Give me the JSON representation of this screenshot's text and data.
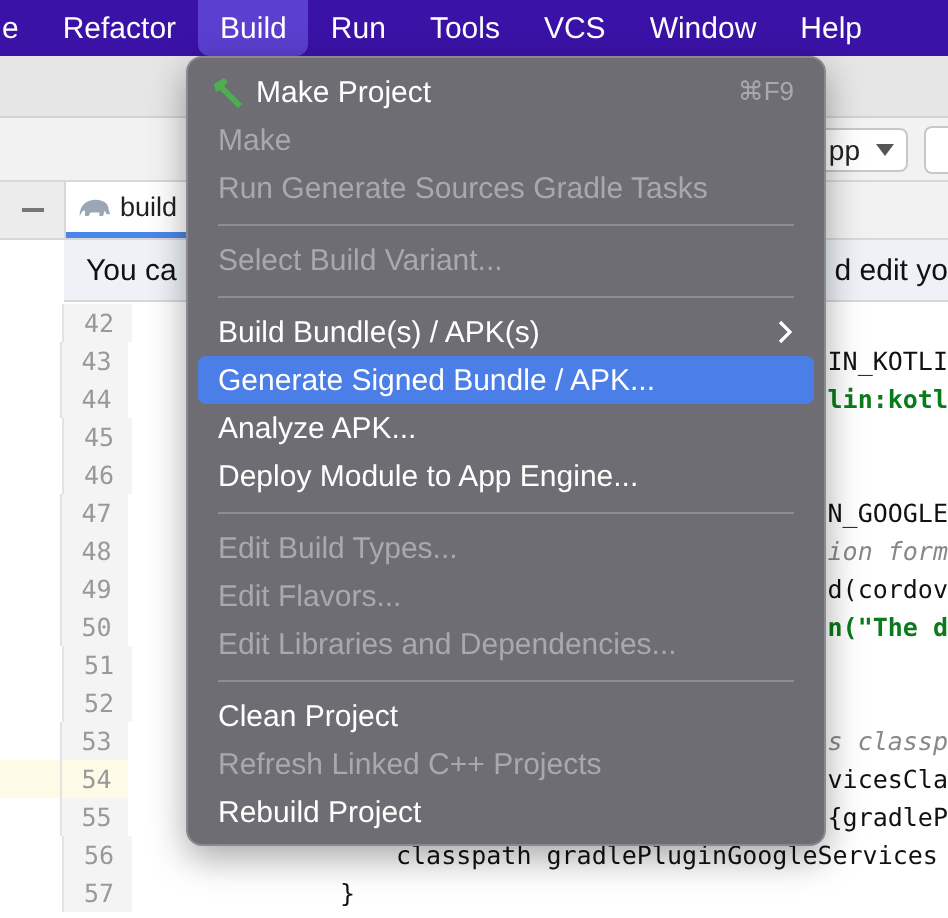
{
  "menu_bar": {
    "items": [
      {
        "label": "e",
        "selected": false
      },
      {
        "label": "Refactor",
        "selected": false
      },
      {
        "label": "Build",
        "selected": true
      },
      {
        "label": "Run",
        "selected": false
      },
      {
        "label": "Tools",
        "selected": false
      },
      {
        "label": "VCS",
        "selected": false
      },
      {
        "label": "Window",
        "selected": false
      },
      {
        "label": "Help",
        "selected": false
      }
    ]
  },
  "toolbar": {
    "config_dropdown": "pp"
  },
  "editor_tab": {
    "label": "build",
    "selected": true
  },
  "banner": {
    "texts": [
      "You ca",
      "d edit yo"
    ]
  },
  "code_lines": [
    {
      "number": "42",
      "kind": "clipped",
      "current": false
    },
    {
      "number": "43",
      "kind": "clipped",
      "text": "IN_KOTLI",
      "current": false
    },
    {
      "number": "44",
      "kind": "clipped_string",
      "text": "lin:kotl",
      "current": false
    },
    {
      "number": "45",
      "kind": "clipped",
      "current": false
    },
    {
      "number": "46",
      "kind": "clipped",
      "current": false
    },
    {
      "number": "47",
      "kind": "clipped",
      "text": "N_GOOGLE",
      "current": false
    },
    {
      "number": "48",
      "kind": "clipped_comment",
      "text": "ion form",
      "current": false
    },
    {
      "number": "49",
      "kind": "clipped",
      "text": "d(cordov",
      "current": false
    },
    {
      "number": "50",
      "kind": "clipped_string",
      "text": "n(\"The d",
      "current": false
    },
    {
      "number": "51",
      "kind": "clipped",
      "current": false
    },
    {
      "number": "52",
      "kind": "clipped",
      "current": false
    },
    {
      "number": "53",
      "kind": "clipped_comment",
      "text": "s classp",
      "current": false
    },
    {
      "number": "54",
      "kind": "clipped",
      "text": "vicesCla",
      "current": true
    },
    {
      "number": "55",
      "kind": "clipped",
      "text": "{gradleP",
      "current": false
    },
    {
      "number": "56",
      "kind": "indent_3",
      "text": "classpath gradlePluginGoogleServices",
      "current": false
    },
    {
      "number": "57",
      "kind": "indent_2",
      "text": "}",
      "current": false
    }
  ],
  "build_menu": {
    "items": [
      {
        "kind": "item",
        "label": "Make Project",
        "shortcut": "⌘F9",
        "disabled": false,
        "selected": false
      },
      {
        "kind": "item",
        "label": "Make",
        "disabled": true,
        "selected": false
      },
      {
        "kind": "item",
        "label": "Run Generate Sources Gradle Tasks",
        "disabled": true,
        "selected": false
      },
      {
        "kind": "separator"
      },
      {
        "kind": "item",
        "label": "Select Build Variant...",
        "disabled": true,
        "selected": false
      },
      {
        "kind": "separator"
      },
      {
        "kind": "submenu",
        "label": "Build Bundle(s) / APK(s)",
        "disabled": false,
        "selected": false
      },
      {
        "kind": "item",
        "label": "Generate Signed Bundle / APK...",
        "disabled": false,
        "selected": true
      },
      {
        "kind": "item",
        "label": "Analyze APK...",
        "disabled": false,
        "selected": false
      },
      {
        "kind": "item",
        "label": "Deploy Module to App Engine...",
        "disabled": false,
        "selected": false
      },
      {
        "kind": "separator"
      },
      {
        "kind": "item",
        "label": "Edit Build Types...",
        "disabled": true,
        "selected": false
      },
      {
        "kind": "item",
        "label": "Edit Flavors...",
        "disabled": true,
        "selected": false
      },
      {
        "kind": "item",
        "label": "Edit Libraries and Dependencies...",
        "disabled": true,
        "selected": false
      },
      {
        "kind": "separator"
      },
      {
        "kind": "item",
        "label": "Clean Project",
        "disabled": false,
        "selected": false
      },
      {
        "kind": "item",
        "label": "Refresh Linked C++ Projects",
        "disabled": true,
        "selected": false
      },
      {
        "kind": "item",
        "label": "Rebuild Project",
        "disabled": false,
        "selected": false
      }
    ]
  }
}
